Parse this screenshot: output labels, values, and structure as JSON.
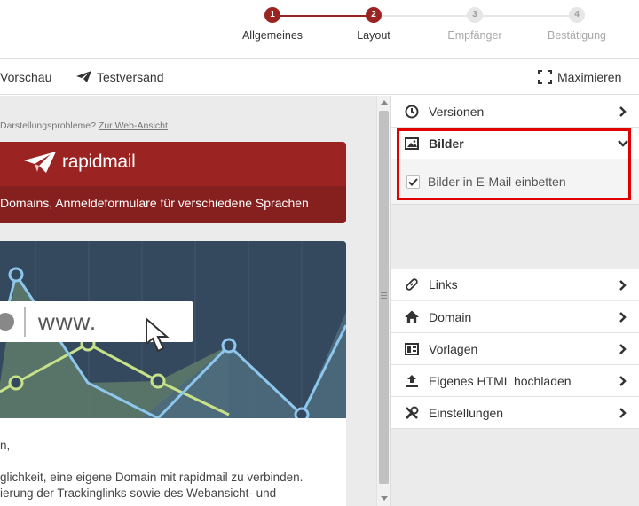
{
  "stepper": {
    "steps": [
      {
        "number": "1",
        "label": "Allgemeines",
        "state": "done"
      },
      {
        "number": "2",
        "label": "Layout",
        "state": "done"
      },
      {
        "number": "3",
        "label": "Empfänger",
        "state": "todo"
      },
      {
        "number": "4",
        "label": "Bestätigung",
        "state": "todo"
      }
    ],
    "colors": {
      "active": "#9b2423",
      "inactive": "#e6e6e6"
    }
  },
  "toolbar": {
    "preview_label": "Vorschau",
    "test_send_label": "Testversand",
    "maximize_label": "Maximieren"
  },
  "preview": {
    "note_text": "Darstellungsprobleme?",
    "web_view_link": "Zur Web-Ansicht",
    "brand_name": "rapidmail",
    "subtitle": "Domains, Anmeldeformulare für verschiedene Sprachen",
    "url_text": "www.",
    "body_lines": [
      "n,",
      "glichkeit, eine eigene Domain mit rapidmail zu verbinden.",
      "ierung der Trackinglinks sowie des Webansicht- und"
    ],
    "colors": {
      "brand": "#9b2423",
      "hero_bg": "#34495e"
    }
  },
  "panel": {
    "items": [
      {
        "label": "Versionen",
        "icon": "clock-icon"
      },
      {
        "label": "Bilder",
        "icon": "image-icon",
        "expanded": true
      },
      {
        "label": "Links",
        "icon": "link-icon"
      },
      {
        "label": "Domain",
        "icon": "home-icon"
      },
      {
        "label": "Vorlagen",
        "icon": "template-icon"
      },
      {
        "label": "Eigenes HTML hochladen",
        "icon": "upload-icon"
      },
      {
        "label": "Einstellungen",
        "icon": "tools-icon"
      }
    ],
    "bilder_option": {
      "label": "Bilder in E-Mail einbetten",
      "checked": true
    }
  }
}
